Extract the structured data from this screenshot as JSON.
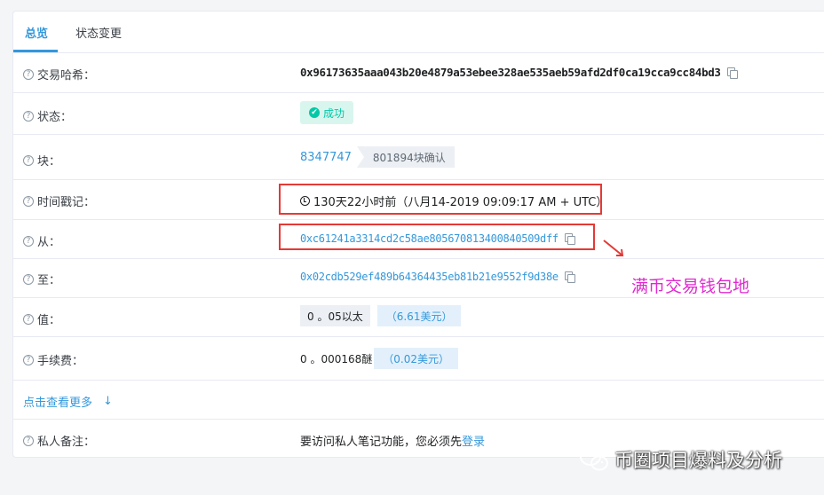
{
  "tabs": [
    {
      "label": "总览",
      "active": true
    },
    {
      "label": "状态变更",
      "active": false
    }
  ],
  "rows": {
    "txhash": {
      "label": "交易哈希：",
      "value": "0x96173635aaa043b20e4879a53ebee328ae535aeb59afd2df0ca19cca9cc84bd3"
    },
    "status": {
      "label": "状态：",
      "value": "成功"
    },
    "block": {
      "label": "块：",
      "number": "8347747",
      "confirmations": "801894块确认"
    },
    "timestamp": {
      "label": "时间戳记：",
      "value": "130天22小时前（八月14-2019 09:09:17 AM + UTC）"
    },
    "from": {
      "label": "从：",
      "value": "0xc61241a3314cd2c58ae805670813400840509dff"
    },
    "to": {
      "label": "至：",
      "value": "0x02cdb529ef489b64364435eb81b21e9552f9d38e"
    },
    "value": {
      "label": "值：",
      "amount": "0 。05以太",
      "usd": "（6.61美元）"
    },
    "fee": {
      "label": "手续费：",
      "amount": "0 。000168醚",
      "usd": "（0.02美元）"
    },
    "note": {
      "label": "私人备注：",
      "text": "要访问私人笔记功能，您必须先",
      "link": "登录"
    }
  },
  "more": {
    "label": "点击查看更多",
    "arrow": "↓"
  },
  "annotation": "满币交易钱包地",
  "watermark": "币圈项目爆料及分析",
  "icons": {
    "help": "question-circle-icon",
    "copy": "copy-icon",
    "success": "check-circle-icon",
    "clock": "clock-icon",
    "wechat": "wechat-logo-icon"
  },
  "colors": {
    "link": "#3498db",
    "success": "#00c9a7",
    "highlight": "#e53935",
    "annotation": "#e02ad0"
  }
}
